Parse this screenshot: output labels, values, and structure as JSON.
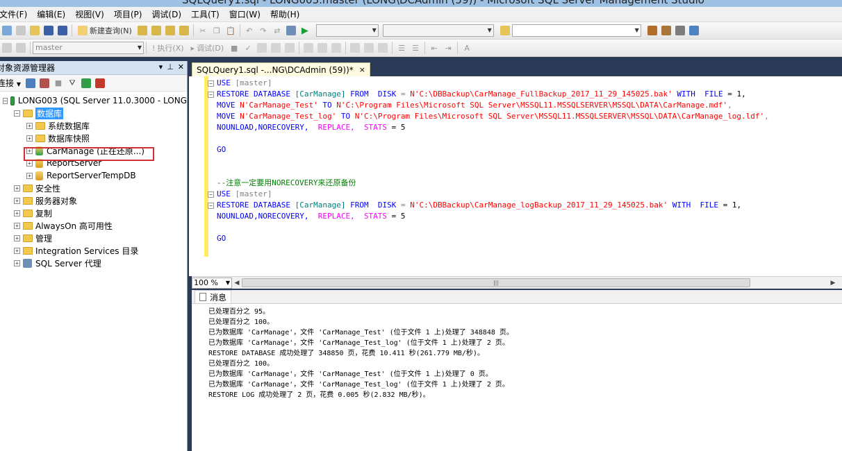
{
  "window": {
    "title": "SQLQuery1.sql - LONG003.master (LONG\\DCAdmin (59)) - Microsoft SQL Server Management Studio"
  },
  "menu": [
    "文件(F)",
    "编辑(E)",
    "视图(V)",
    "项目(P)",
    "调试(D)",
    "工具(T)",
    "窗口(W)",
    "帮助(H)"
  ],
  "toolbar1": {
    "new_query": "新建查询(N)"
  },
  "toolbar2": {
    "database": "master",
    "execute": "执行(X)",
    "debug": "调试(D)"
  },
  "object_explorer": {
    "title": "对象资源管理器",
    "connect": "连接",
    "server": "LONG003 (SQL Server 11.0.3000 - LONG",
    "databases": "数据库",
    "system_databases": "系统数据库",
    "snapshots": "数据库快照",
    "carmanage": "CarManage (正在还原...)",
    "reportserver": "ReportServer",
    "reportservertemp": "ReportServerTempDB",
    "security": "安全性",
    "server_objects": "服务器对象",
    "replication": "复制",
    "alwayson": "AlwaysOn 高可用性",
    "management": "管理",
    "integration": "Integration Services 目录",
    "agent": "SQL Server 代理"
  },
  "editor": {
    "tab_title": "SQLQuery1.sql -...NG\\DCAdmin (59))*",
    "tab_close": "×",
    "lines": {
      "l1_use": "USE",
      "l1_db": "[master]",
      "l2_restore": "RESTORE DATABASE",
      "l2_db": "[CarManage]",
      "l2_from": "FROM",
      "l2_disk": "DISK",
      "l2_eq": " = ",
      "l2_path": "N'C:\\DBBackup\\CarManage_FullBackup_2017_11_29_145025.bak'",
      "l2_with": "WITH",
      "l2_file": "FILE",
      "l2_val": " = 1,",
      "l3_move": "MOVE",
      "l3_name": "N'CarManage_Test'",
      "l3_to": "TO",
      "l3_path": "N'C:\\Program Files\\Microsoft SQL Server\\MSSQL11.MSSQLSERVER\\MSSQL\\DATA\\CarManage.mdf'",
      "l3_comma": ",",
      "l4_move": "MOVE",
      "l4_name": "N'CarManage_Test_log'",
      "l4_to": "TO",
      "l4_path": "N'C:\\Program Files\\Microsoft SQL Server\\MSSQL11.MSSQLSERVER\\MSSQL\\DATA\\CarManage_log.ldf'",
      "l4_comma": ",",
      "l5_opts": "NOUNLOAD,NORECOVERY,",
      "l5_replace": "REPLACE,",
      "l5_stats": "STATS",
      "l5_val": " = 5",
      "go": "GO",
      "comment": "--注意一定要用NORECOVERY来还原备份",
      "l10_use": "USE",
      "l10_db": "[master]",
      "l11_restore": "RESTORE DATABASE",
      "l11_db": "[CarManage]",
      "l11_from": "FROM",
      "l11_disk": "DISK",
      "l11_eq": " = ",
      "l11_path": "N'C:\\DBBackup\\CarManage_logBackup_2017_11_29_145025.bak'",
      "l11_with": "WITH",
      "l11_file": "FILE",
      "l11_val": " = 1,",
      "l12_opts": "NOUNLOAD,NORECOVERY,",
      "l12_replace": "REPLACE,",
      "l12_stats": "STATS",
      "l12_val": " = 5",
      "go2": "GO"
    },
    "zoom": "100 %"
  },
  "results": {
    "tab": "消息",
    "messages": [
      "已处理百分之 95。",
      "已处理百分之 100。",
      "已为数据库 'CarManage'，文件 'CarManage_Test' (位于文件 1 上)处理了 348848 页。",
      "已为数据库 'CarManage'，文件 'CarManage_Test_log' (位于文件 1 上)处理了 2 页。",
      "RESTORE DATABASE 成功处理了 348850 页，花费 10.411 秒(261.779 MB/秒)。",
      "已处理百分之 100。",
      "已为数据库 'CarManage'，文件 'CarManage_Test' (位于文件 1 上)处理了 0 页。",
      "已为数据库 'CarManage'，文件 'CarManage_Test_log' (位于文件 1 上)处理了 2 页。",
      "RESTORE LOG 成功处理了 2 页，花费 0.005 秒(2.832 MB/秒)。"
    ]
  },
  "colors": {
    "keyword": "#0000ff",
    "string": "#ff0000",
    "comment": "#008000",
    "highlight_box": "#d23030",
    "selection": "#3399ff"
  },
  "icons": [
    "new-query-icon",
    "open-icon",
    "save-icon",
    "execute-icon",
    "connect-icon",
    "refresh-icon",
    "filter-icon",
    "folder-icon",
    "database-icon",
    "server-icon",
    "messages-icon"
  ]
}
